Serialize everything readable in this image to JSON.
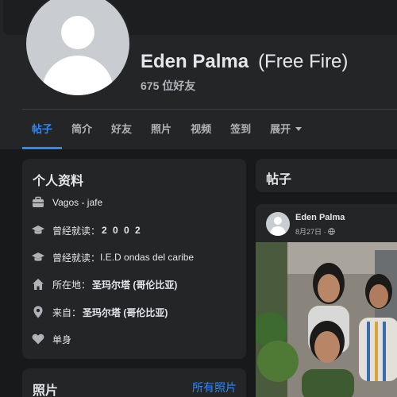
{
  "profile": {
    "name": "Eden Palma",
    "alt_name": "(Free Fire)",
    "friends": "675 位好友"
  },
  "tabs": [
    {
      "label": "帖子",
      "active": true
    },
    {
      "label": "简介"
    },
    {
      "label": "好友"
    },
    {
      "label": "照片"
    },
    {
      "label": "视频"
    },
    {
      "label": "签到"
    },
    {
      "label": "展开"
    }
  ],
  "intro": {
    "title": "个人资料",
    "items": [
      {
        "icon": "briefcase-icon",
        "prefix": "",
        "value": "Vagos - jafe"
      },
      {
        "icon": "graduation-cap-icon",
        "prefix": "曾经就读：",
        "value": "2 0 0 2"
      },
      {
        "icon": "graduation-cap-icon",
        "prefix": "曾经就读：",
        "value": "I.E.D ondas del caribe"
      },
      {
        "icon": "home-icon",
        "prefix": "所在地：",
        "value": "圣玛尔塔 (哥伦比亚)"
      },
      {
        "icon": "location-pin-icon",
        "prefix": "来自：",
        "value": "圣玛尔塔 (哥伦比亚)"
      },
      {
        "icon": "heart-icon",
        "prefix": "",
        "value": "单身"
      }
    ]
  },
  "photos": {
    "title": "照片",
    "link": "所有照片"
  },
  "posts": {
    "title": "帖子",
    "post": {
      "author": "Eden Palma",
      "date": "8月27日 ·"
    }
  },
  "colors": {
    "background": "#18191a",
    "card": "#242526",
    "accent": "#2d88ff",
    "text_primary": "#e4e6eb",
    "text_secondary": "#b0b3b8"
  }
}
